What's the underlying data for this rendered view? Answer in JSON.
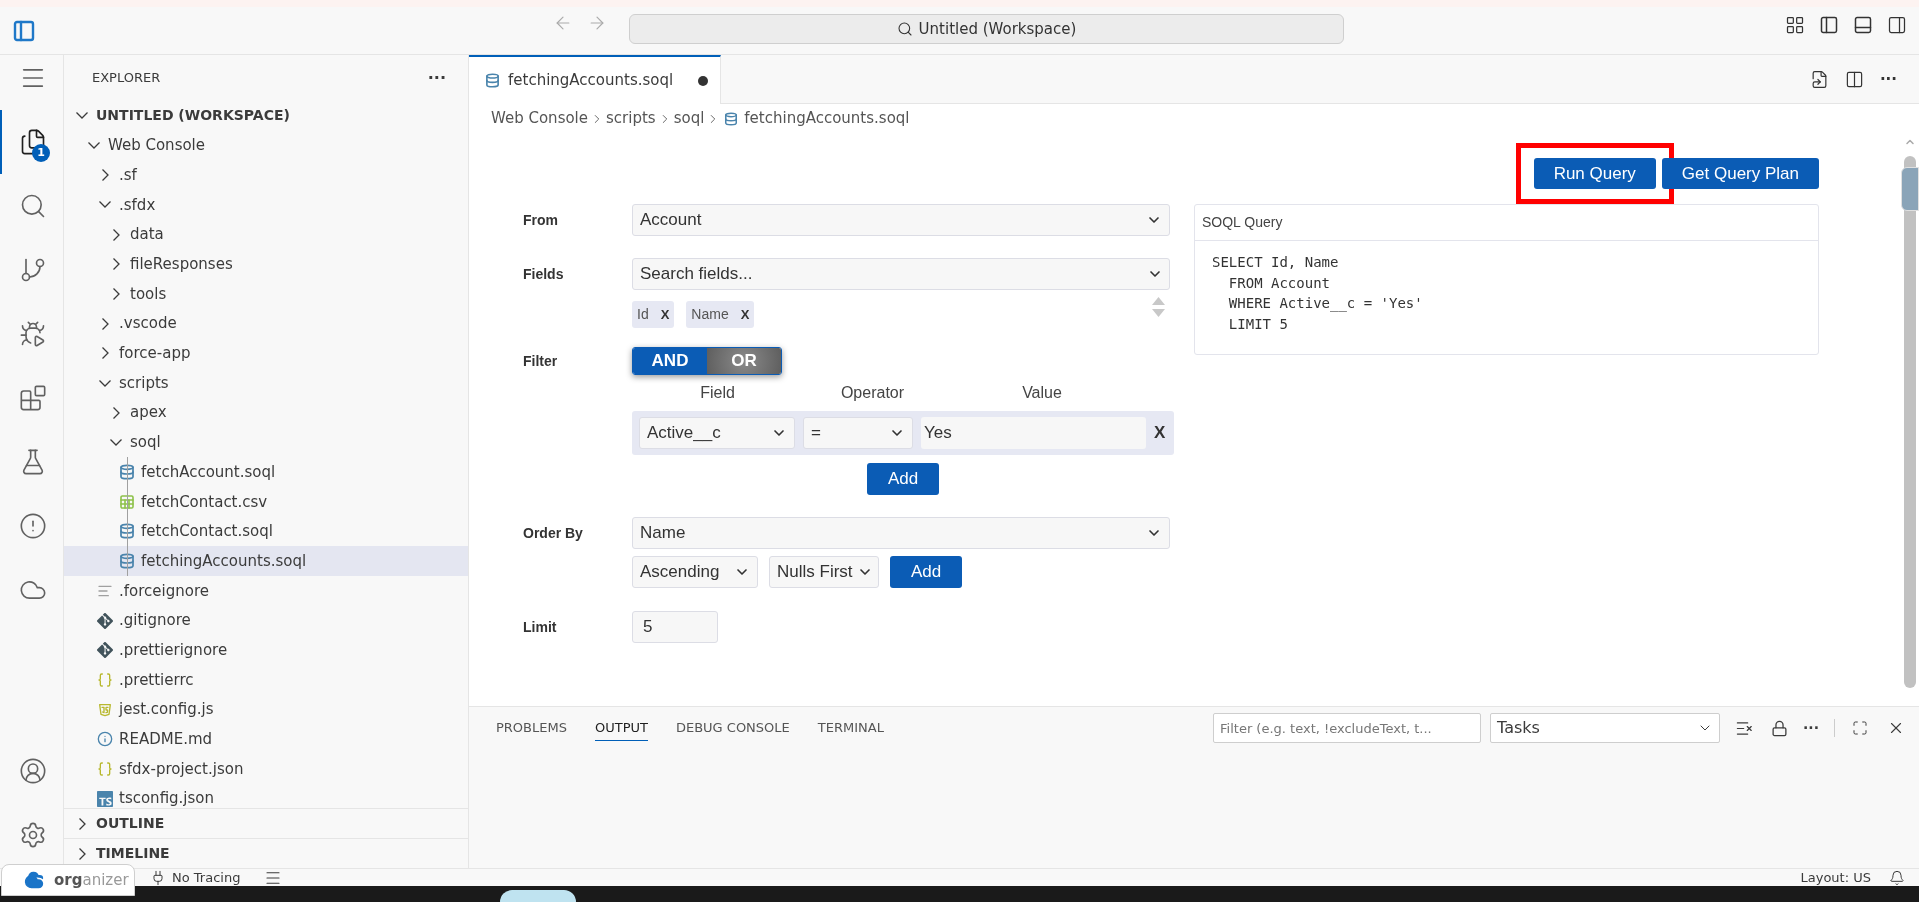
{
  "title_bar": {
    "search": "Untitled (Workspace)"
  },
  "activity_bar": [
    {
      "kind": "menu",
      "selected": false
    },
    {
      "kind": "explorer",
      "selected": true,
      "badge": "1"
    },
    {
      "kind": "search",
      "selected": false
    },
    {
      "kind": "source-control",
      "selected": false
    },
    {
      "kind": "run-debug",
      "selected": false
    },
    {
      "kind": "extensions",
      "selected": false
    },
    {
      "kind": "testing",
      "selected": false
    },
    {
      "kind": "problems",
      "selected": false
    },
    {
      "kind": "cloud",
      "selected": false
    },
    {
      "kind": "account",
      "selected": false
    },
    {
      "kind": "settings",
      "selected": false
    }
  ],
  "explorer": {
    "title": "EXPLORER",
    "more": "···",
    "workspace": {
      "label": "UNTITLED (WORKSPACE)",
      "expanded": true,
      "children": [
        {
          "label": "Web Console",
          "kind": "folder",
          "expanded": true,
          "selected": false,
          "children": [
            {
              "label": ".sf",
              "kind": "folder",
              "expanded": false,
              "selected": false
            },
            {
              "label": ".sfdx",
              "kind": "folder",
              "expanded": true,
              "selected": false,
              "children": [
                {
                  "label": "data",
                  "kind": "folder",
                  "expanded": false,
                  "selected": false
                },
                {
                  "label": "fileResponses",
                  "kind": "folder",
                  "expanded": false,
                  "selected": false
                },
                {
                  "label": "tools",
                  "kind": "folder",
                  "expanded": false,
                  "selected": false
                }
              ]
            },
            {
              "label": ".vscode",
              "kind": "folder",
              "expanded": false,
              "selected": false
            },
            {
              "label": "force-app",
              "kind": "folder",
              "expanded": false,
              "selected": false
            },
            {
              "label": "scripts",
              "kind": "folder",
              "expanded": true,
              "selected": false,
              "children": [
                {
                  "label": "apex",
                  "kind": "folder",
                  "expanded": false,
                  "selected": false
                },
                {
                  "label": "soql",
                  "kind": "folder",
                  "expanded": true,
                  "selected": false,
                  "children": [
                    {
                      "label": "fetchAccount.soql",
                      "kind": "soql",
                      "selected": false
                    },
                    {
                      "label": "fetchContact.csv",
                      "kind": "csv",
                      "selected": false
                    },
                    {
                      "label": "fetchContact.soql",
                      "kind": "soql",
                      "selected": false
                    },
                    {
                      "label": "fetchingAccounts.soql",
                      "kind": "soql",
                      "selected": true
                    }
                  ]
                }
              ]
            },
            {
              "label": ".forceignore",
              "kind": "lines",
              "selected": false
            },
            {
              "label": ".gitignore",
              "kind": "git",
              "selected": false
            },
            {
              "label": ".prettierignore",
              "kind": "git",
              "selected": false
            },
            {
              "label": ".prettierrc",
              "kind": "json",
              "selected": false
            },
            {
              "label": "jest.config.js",
              "kind": "js",
              "selected": false
            },
            {
              "label": "README.md",
              "kind": "info",
              "selected": false
            },
            {
              "label": "sfdx-project.json",
              "kind": "json",
              "selected": false
            },
            {
              "label": "tsconfig.json",
              "kind": "ts",
              "selected": false
            }
          ]
        }
      ]
    },
    "sections": [
      {
        "label": "OUTLINE",
        "expanded": false
      },
      {
        "label": "TIMELINE",
        "expanded": false
      }
    ]
  },
  "editor": {
    "tabs": [
      {
        "label": "fetchingAccounts.soql",
        "selected": true,
        "modified": true
      }
    ],
    "breadcrumb": [
      "Web Console",
      "scripts",
      "soql",
      "fetchingAccounts.soql"
    ]
  },
  "query_builder": {
    "buttons": [
      {
        "label": "Run Query",
        "highlighted": true
      },
      {
        "label": "Get Query Plan",
        "highlighted": false
      }
    ],
    "from": {
      "label": "From",
      "value": "Account"
    },
    "fields": {
      "label": "Fields",
      "placeholder": "Search fields...",
      "chips": [
        {
          "label": "Id",
          "remove": "X"
        },
        {
          "label": "Name",
          "remove": "X"
        }
      ]
    },
    "filter": {
      "label": "Filter",
      "modes": [
        {
          "label": "AND",
          "selected": true
        },
        {
          "label": "OR",
          "selected": false
        }
      ],
      "columns": [
        "Field",
        "Operator",
        "Value"
      ],
      "conditions": [
        {
          "field": "Active__c",
          "operator": "=",
          "value": "Yes",
          "remove": "X"
        }
      ],
      "add": "Add"
    },
    "order_by": {
      "label": "Order By",
      "field": "Name",
      "direction": "Ascending",
      "nulls": "Nulls First",
      "add": "Add"
    },
    "limit": {
      "label": "Limit",
      "value": "5"
    }
  },
  "soql_panel": {
    "title": "SOQL Query",
    "lines": [
      "SELECT Id, Name",
      "  FROM Account",
      "  WHERE Active__c = 'Yes'",
      "  LIMIT 5"
    ]
  },
  "panel": {
    "tabs": [
      {
        "label": "PROBLEMS",
        "selected": false
      },
      {
        "label": "OUTPUT",
        "selected": true
      },
      {
        "label": "DEBUG CONSOLE",
        "selected": false
      },
      {
        "label": "TERMINAL",
        "selected": false
      }
    ],
    "filter_placeholder": "Filter (e.g. text, !excludeText, t...",
    "channel": "Tasks",
    "more": "···"
  },
  "status_bar": {
    "org": "**org**anizer",
    "tracing": "No Tracing",
    "layout": "Layout: US"
  }
}
